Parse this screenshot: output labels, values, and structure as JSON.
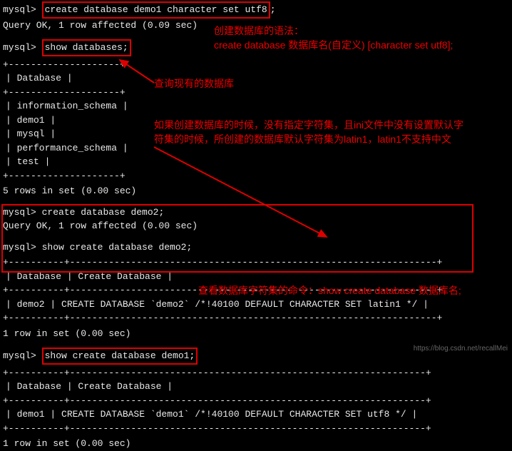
{
  "blocks": {
    "line1_prompt": "mysql>",
    "line1_cmd": "create database demo1 character set utf8",
    "line1_tail": ";",
    "line2": "Query OK, 1 row affected (0.09 sec)",
    "line3_prompt": "mysql>",
    "line3_cmd": "show databases;",
    "db_table_border": "+--------------------+",
    "db_table_header": "| Database           |",
    "db_rows": [
      "| information_schema |",
      "| demo1              |",
      "| mysql              |",
      "| performance_schema |",
      "| test               |"
    ],
    "db_rows_footer": "5 rows in set (0.00 sec)",
    "line4_prompt": "mysql>",
    "line4_cmd": "create database demo2;",
    "line5": "Query OK, 1 row affected (0.00 sec)",
    "line6_prompt": "mysql>",
    "line6_cmd": "show create database demo2;",
    "tbl2_border": "+----------+------------------------------------------------------------------+",
    "tbl2_header": "| Database | Create Database                                                  |",
    "tbl2_row": "| demo2    | CREATE DATABASE `demo2` /*!40100 DEFAULT CHARACTER SET latin1 */ |",
    "tbl2_footer": "1 row in set (0.00 sec)",
    "line7_prompt": "mysql>",
    "line7_cmd": "show create database demo1;",
    "tbl3_border": "+----------+----------------------------------------------------------------+",
    "tbl3_header": "| Database | Create Database                                                |",
    "tbl3_row": "| demo1    | CREATE DATABASE `demo1` /*!40100 DEFAULT CHARACTER SET utf8 */ |",
    "tbl3_footer": "1 row in set (0.00 sec)"
  },
  "annotations": {
    "a1_line1": "创建数据库的语法：",
    "a1_line2": "create database 数据库名(自定义) [character set utf8];",
    "a2": "查询现有的数据库",
    "a3_line1": "如果创建数据库的时候，没有指定字符集，且ini文件中没有设置默认字",
    "a3_line2": "符集的时候，所创建的数据库默认字符集为latin1，latin1不支持中文",
    "a4": "查看数据库字符集的命令：show create database 数据库名;"
  },
  "watermark": "https://blog.csdn.net/recallMei"
}
